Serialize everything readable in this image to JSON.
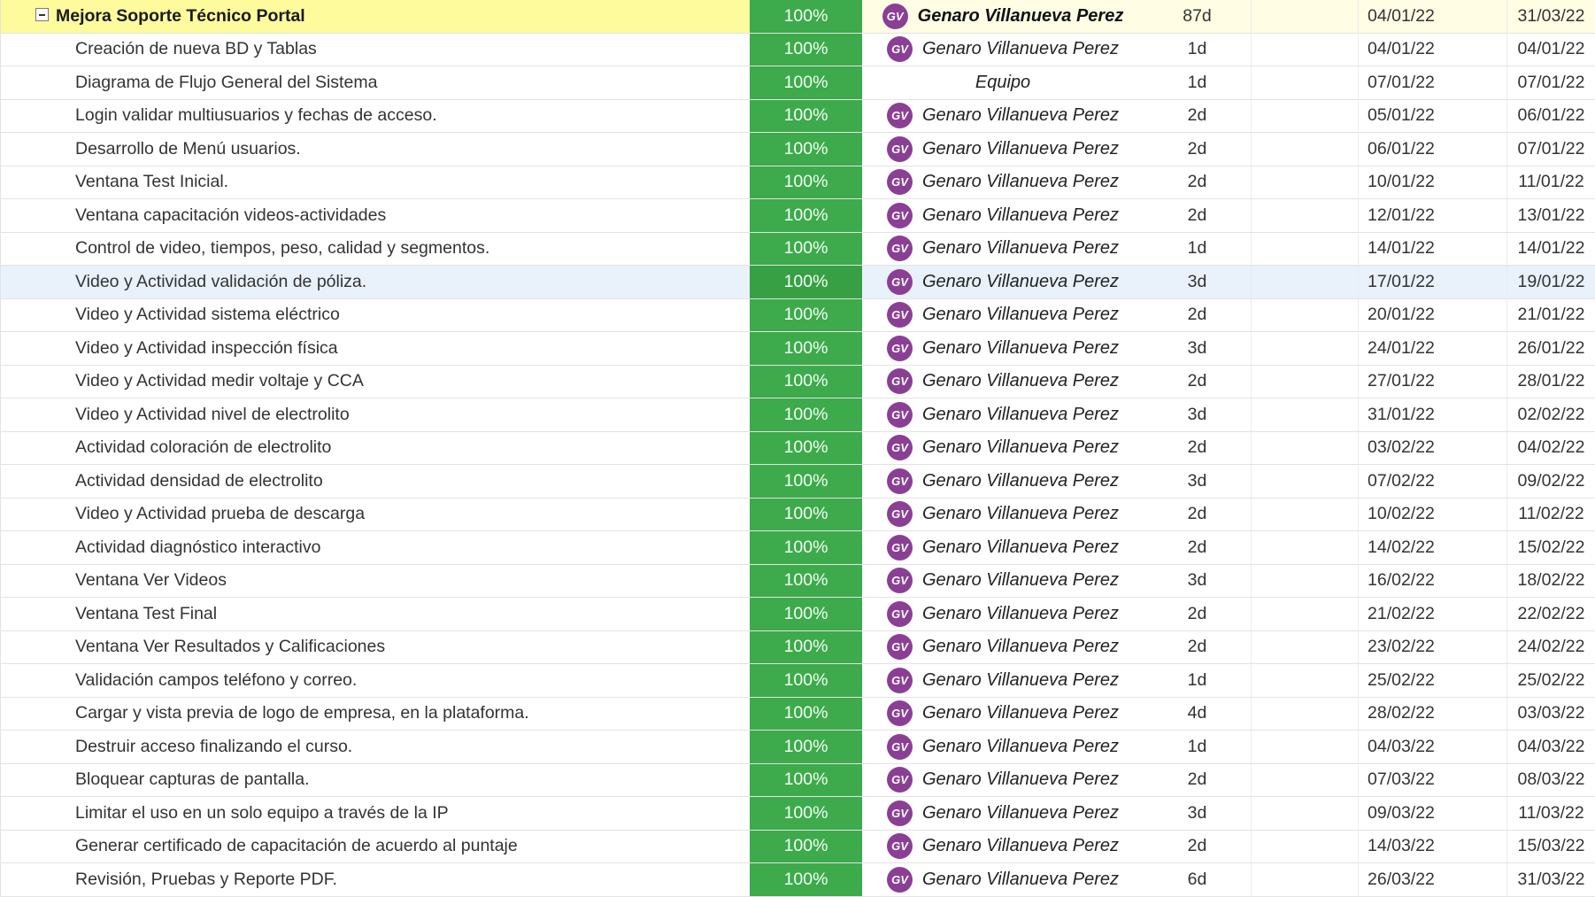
{
  "colors": {
    "progress_green": "#3daa4b",
    "parent_yellow": "#fdfb9c",
    "avatar_purple": "#8a3f94",
    "selected_row": "#e9f1fb"
  },
  "parent": {
    "task": "Mejora Soporte Técnico Portal",
    "pct": "100%",
    "initials": "GV",
    "assignee": "Genaro Villanueva Perez",
    "duration": "87d",
    "start": "04/01/22",
    "end": "31/03/22"
  },
  "rows": [
    {
      "task": "Creación de nueva BD y Tablas",
      "pct": "100%",
      "initials": "GV",
      "assignee": "Genaro Villanueva Perez",
      "duration": "1d",
      "start": "04/01/22",
      "end": "04/01/22"
    },
    {
      "task": "Diagrama de Flujo General del Sistema",
      "pct": "100%",
      "initials": "",
      "assignee": "Equipo",
      "duration": "1d",
      "start": "07/01/22",
      "end": "07/01/22"
    },
    {
      "task": "Login validar multiusuarios y fechas de acceso.",
      "pct": "100%",
      "initials": "GV",
      "assignee": "Genaro Villanueva Perez",
      "duration": "2d",
      "start": "05/01/22",
      "end": "06/01/22"
    },
    {
      "task": "Desarrollo de Menú usuarios.",
      "pct": "100%",
      "initials": "GV",
      "assignee": "Genaro Villanueva Perez",
      "duration": "2d",
      "start": "06/01/22",
      "end": "07/01/22"
    },
    {
      "task": "Ventana Test Inicial.",
      "pct": "100%",
      "initials": "GV",
      "assignee": "Genaro Villanueva Perez",
      "duration": "2d",
      "start": "10/01/22",
      "end": "11/01/22"
    },
    {
      "task": "Ventana capacitación videos-actividades",
      "pct": "100%",
      "initials": "GV",
      "assignee": "Genaro Villanueva Perez",
      "duration": "2d",
      "start": "12/01/22",
      "end": "13/01/22"
    },
    {
      "task": "Control de video, tiempos, peso, calidad y segmentos.",
      "pct": "100%",
      "initials": "GV",
      "assignee": "Genaro Villanueva Perez",
      "duration": "1d",
      "start": "14/01/22",
      "end": "14/01/22"
    },
    {
      "task": "Video y Actividad validación de póliza.",
      "pct": "100%",
      "initials": "GV",
      "assignee": "Genaro Villanueva Perez",
      "duration": "3d",
      "start": "17/01/22",
      "end": "19/01/22"
    },
    {
      "task": "Video y Actividad sistema eléctrico",
      "pct": "100%",
      "initials": "GV",
      "assignee": "Genaro Villanueva Perez",
      "duration": "2d",
      "start": "20/01/22",
      "end": "21/01/22"
    },
    {
      "task": "Video y Actividad inspección física",
      "pct": "100%",
      "initials": "GV",
      "assignee": "Genaro Villanueva Perez",
      "duration": "3d",
      "start": "24/01/22",
      "end": "26/01/22"
    },
    {
      "task": "Video y Actividad medir voltaje y CCA",
      "pct": "100%",
      "initials": "GV",
      "assignee": "Genaro Villanueva Perez",
      "duration": "2d",
      "start": "27/01/22",
      "end": "28/01/22"
    },
    {
      "task": "Video y Actividad nivel de electrolito",
      "pct": "100%",
      "initials": "GV",
      "assignee": "Genaro Villanueva Perez",
      "duration": "3d",
      "start": "31/01/22",
      "end": "02/02/22"
    },
    {
      "task": "Actividad coloración de electrolito",
      "pct": "100%",
      "initials": "GV",
      "assignee": "Genaro Villanueva Perez",
      "duration": "2d",
      "start": "03/02/22",
      "end": "04/02/22"
    },
    {
      "task": "Actividad densidad de electrolito",
      "pct": "100%",
      "initials": "GV",
      "assignee": "Genaro Villanueva Perez",
      "duration": "3d",
      "start": "07/02/22",
      "end": "09/02/22"
    },
    {
      "task": "Video y Actividad prueba de descarga",
      "pct": "100%",
      "initials": "GV",
      "assignee": "Genaro Villanueva Perez",
      "duration": "2d",
      "start": "10/02/22",
      "end": "11/02/22"
    },
    {
      "task": "Actividad diagnóstico interactivo",
      "pct": "100%",
      "initials": "GV",
      "assignee": "Genaro Villanueva Perez",
      "duration": "2d",
      "start": "14/02/22",
      "end": "15/02/22"
    },
    {
      "task": "Ventana Ver Videos",
      "pct": "100%",
      "initials": "GV",
      "assignee": "Genaro Villanueva Perez",
      "duration": "3d",
      "start": "16/02/22",
      "end": "18/02/22"
    },
    {
      "task": "Ventana Test Final",
      "pct": "100%",
      "initials": "GV",
      "assignee": "Genaro Villanueva Perez",
      "duration": "2d",
      "start": "21/02/22",
      "end": "22/02/22"
    },
    {
      "task": "Ventana Ver Resultados y Calificaciones",
      "pct": "100%",
      "initials": "GV",
      "assignee": "Genaro Villanueva Perez",
      "duration": "2d",
      "start": "23/02/22",
      "end": "24/02/22"
    },
    {
      "task": "Validación campos teléfono y correo.",
      "pct": "100%",
      "initials": "GV",
      "assignee": "Genaro Villanueva Perez",
      "duration": "1d",
      "start": "25/02/22",
      "end": "25/02/22"
    },
    {
      "task": "Cargar y vista previa de logo de empresa, en la plataforma.",
      "pct": "100%",
      "initials": "GV",
      "assignee": "Genaro Villanueva Perez",
      "duration": "4d",
      "start": "28/02/22",
      "end": "03/03/22"
    },
    {
      "task": "Destruir acceso finalizando el curso.",
      "pct": "100%",
      "initials": "GV",
      "assignee": "Genaro Villanueva Perez",
      "duration": "1d",
      "start": "04/03/22",
      "end": "04/03/22"
    },
    {
      "task": "Bloquear capturas de pantalla.",
      "pct": "100%",
      "initials": "GV",
      "assignee": "Genaro Villanueva Perez",
      "duration": "2d",
      "start": "07/03/22",
      "end": "08/03/22"
    },
    {
      "task": "Limitar el uso en un solo equipo a través de la IP",
      "pct": "100%",
      "initials": "GV",
      "assignee": "Genaro Villanueva Perez",
      "duration": "3d",
      "start": "09/03/22",
      "end": "11/03/22"
    },
    {
      "task": "Generar certificado de capacitación de acuerdo al puntaje",
      "pct": "100%",
      "initials": "GV",
      "assignee": "Genaro Villanueva Perez",
      "duration": "2d",
      "start": "14/03/22",
      "end": "15/03/22"
    },
    {
      "task": "Revisión, Pruebas y Reporte PDF.",
      "pct": "100%",
      "initials": "GV",
      "assignee": "Genaro Villanueva Perez",
      "duration": "6d",
      "start": "26/03/22",
      "end": "31/03/22"
    }
  ]
}
